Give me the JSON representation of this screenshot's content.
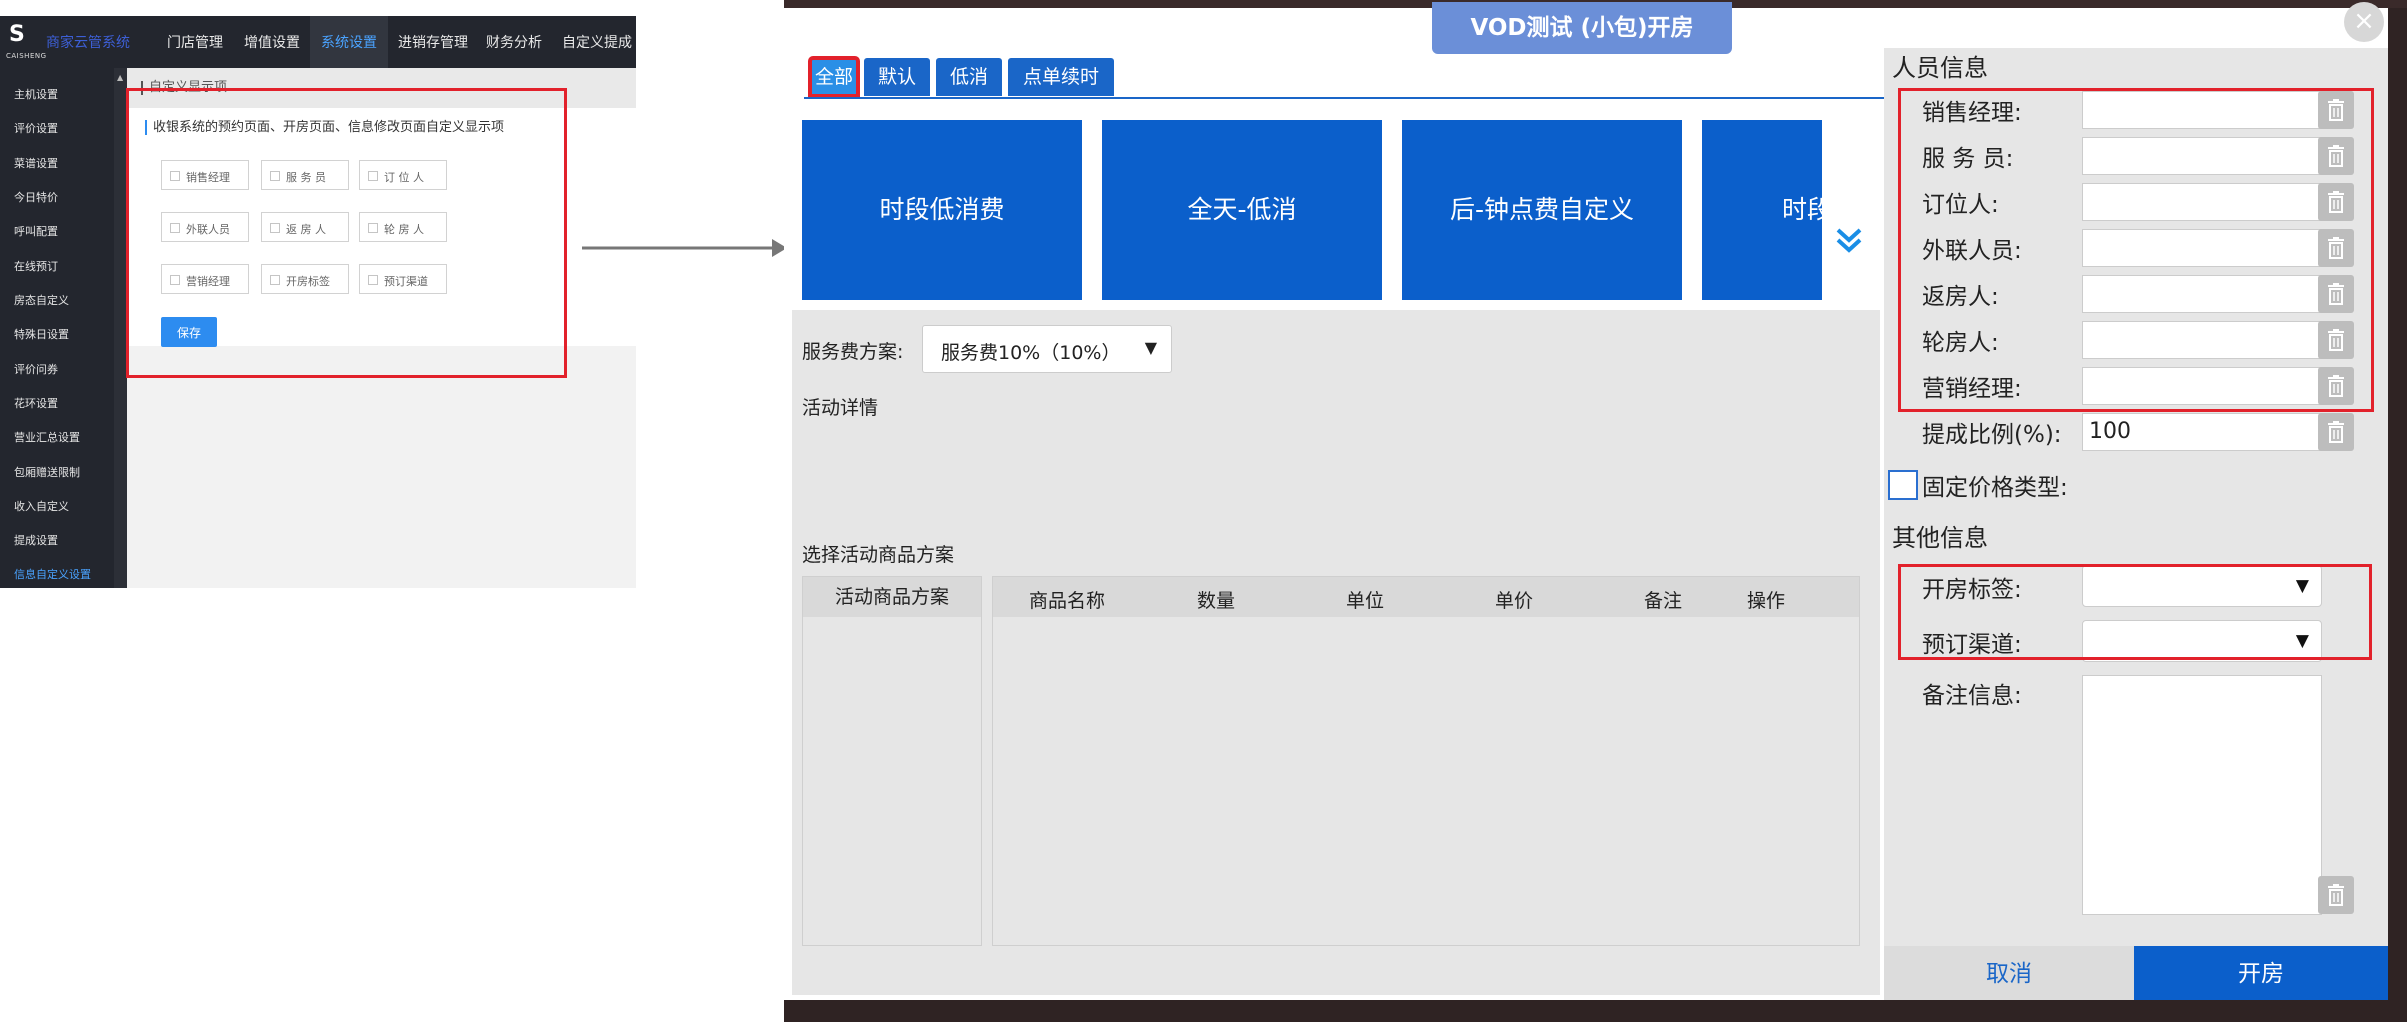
{
  "admin": {
    "logo_word": "CAISHENG",
    "system_name": "商家云管系统",
    "nav": [
      "门店管理",
      "增值设置",
      "系统设置",
      "进销存管理",
      "财务分析",
      "自定义提成"
    ],
    "nav_active": "系统设置",
    "sidebar": [
      "主机设置",
      "评价设置",
      "菜谱设置",
      "今日特价",
      "呼叫配置",
      "在线预订",
      "房态自定义",
      "特殊日设置",
      "评价问券",
      "花环设置",
      "营业汇总设置",
      "包厢赠送限制",
      "收入自定义",
      "提成设置",
      "信息自定义设置"
    ],
    "sidebar_active": "信息自定义设置",
    "section_title": "自定义显示项",
    "description": "收银系统的预约页面、开房页面、信息修改页面自定义显示项",
    "checkboxes": [
      [
        "销售经理",
        "服 务 员",
        "订 位 人"
      ],
      [
        "外联人员",
        "返 房 人",
        "轮 房 人"
      ],
      [
        "营销经理",
        "开房标签",
        "预订渠道"
      ]
    ],
    "save_label": "保存"
  },
  "dialog": {
    "title": "VOD测试 (小包)开房",
    "close_glyph": "×",
    "tabs": [
      "全部",
      "默认",
      "低消",
      "点单续时"
    ],
    "active_tab": "全部",
    "tiles": [
      "时段低消费",
      "全天-低消",
      "后-钟点费自定义",
      "时段"
    ],
    "more_glyph": "⌄⌄",
    "service_fee_label": "服务费方案:",
    "service_fee_value": "服务费10%（10%）",
    "activity_detail_label": "活动详情",
    "activity_goods_label": "选择活动商品方案",
    "plan_column": "活动商品方案",
    "goods_columns": [
      "商品名称",
      "数量",
      "单位",
      "单价",
      "备注",
      "操作"
    ],
    "personnel_title": "人员信息",
    "personnel": [
      {
        "label": "销售经理:",
        "value": ""
      },
      {
        "label": "服 务 员:",
        "value": ""
      },
      {
        "label": "订位人:",
        "value": ""
      },
      {
        "label": "外联人员:",
        "value": ""
      },
      {
        "label": "返房人:",
        "value": ""
      },
      {
        "label": "轮房人:",
        "value": ""
      },
      {
        "label": "营销经理:",
        "value": ""
      },
      {
        "label": "提成比例(%):",
        "value": "100"
      }
    ],
    "fixed_price_label": "固定价格类型:",
    "other_title": "其他信息",
    "room_tag_label": "开房标签:",
    "booking_channel_label": "预订渠道:",
    "remark_label": "备注信息:",
    "cancel_label": "取消",
    "open_label": "开房"
  },
  "colors": {
    "accent_blue": "#0b5fcb",
    "highlight_red": "#e2212b",
    "admin_dark": "#23262e"
  }
}
